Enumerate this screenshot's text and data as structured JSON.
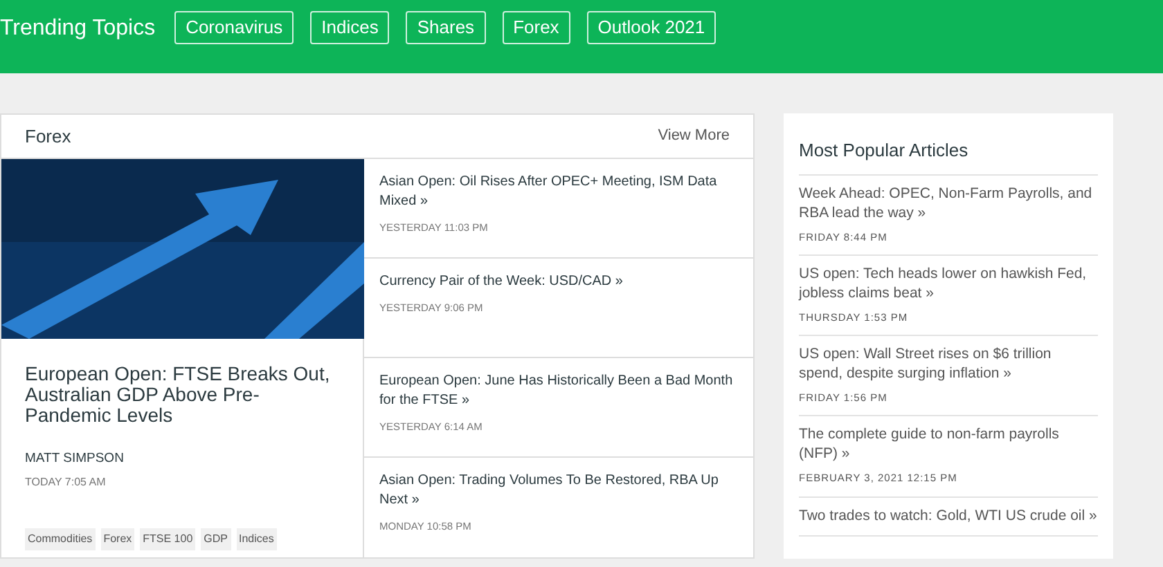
{
  "header": {
    "title": "Trending Topics",
    "topics": [
      "Coronavirus",
      "Indices",
      "Shares",
      "Forex",
      "Outlook 2021"
    ]
  },
  "forex": {
    "title": "Forex",
    "view_more": "View More",
    "feature": {
      "headline": "European Open: FTSE Breaks Out, Australian GDP Above Pre-Pandemic Levels",
      "author": "MATT SIMPSON",
      "time": "TODAY 7:05 AM",
      "tags": [
        "Commodities",
        "Forex",
        "FTSE 100",
        "GDP",
        "Indices"
      ]
    },
    "articles": [
      {
        "title": "Asian Open: Oil Rises After OPEC+ Meeting, ISM Data Mixed »",
        "time": "YESTERDAY 11:03 PM"
      },
      {
        "title": "Currency Pair of the Week: USD/CAD »",
        "time": "YESTERDAY 9:06 PM"
      },
      {
        "title": "European Open: June Has Historically Been a Bad Month for the FTSE »",
        "time": "YESTERDAY 6:14 AM"
      },
      {
        "title": "Asian Open: Trading Volumes To Be Restored, RBA Up Next »",
        "time": "MONDAY 10:58 PM"
      }
    ]
  },
  "popular": {
    "title": "Most Popular Articles",
    "articles": [
      {
        "title": "Week Ahead: OPEC, Non-Farm Payrolls, and RBA lead the way »",
        "time": "FRIDAY 8:44 PM"
      },
      {
        "title": "US open: Tech heads lower on hawkish Fed, jobless claims beat »",
        "time": "THURSDAY 1:53 PM"
      },
      {
        "title": "US open: Wall Street rises on $6 trillion spend, despite surging inflation »",
        "time": "FRIDAY 1:56 PM"
      },
      {
        "title": "The complete guide to non-farm payrolls (NFP)  »",
        "time": "FEBRUARY 3, 2021 12:15 PM"
      },
      {
        "title": "Two trades to watch: Gold, WTI US crude oil »"
      }
    ]
  }
}
